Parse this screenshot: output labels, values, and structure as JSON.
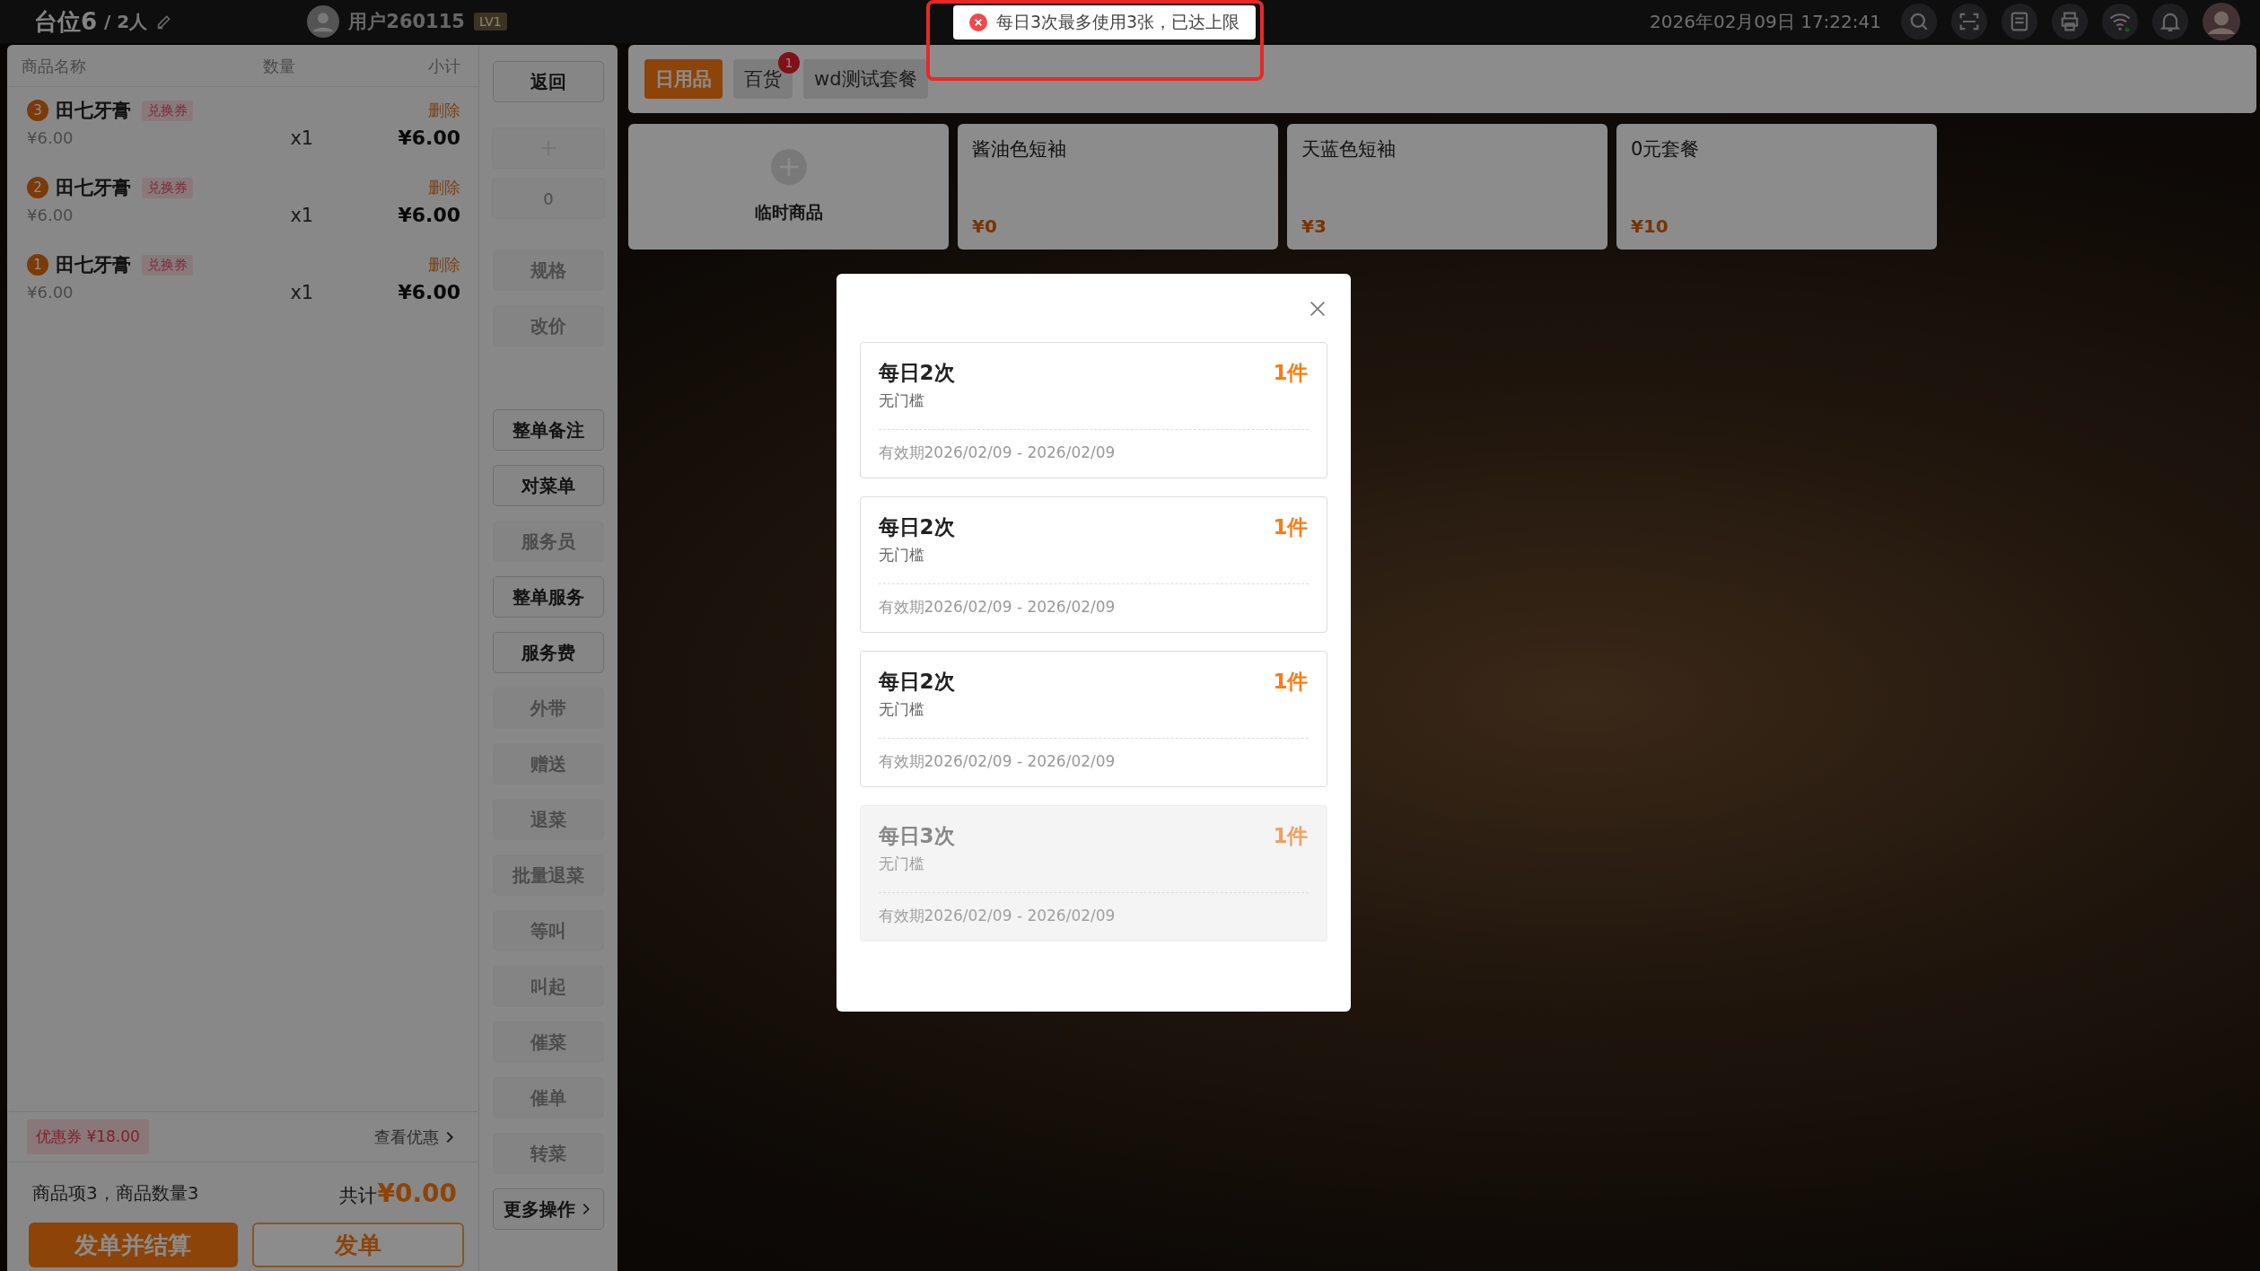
{
  "header": {
    "table": "台位6",
    "guests": "/ 2人",
    "user": "用户260115",
    "level": "LV1",
    "datetime": "2026年02月09日 17:22:41"
  },
  "toast": {
    "message": "每日3次最多使用3张，已达上限"
  },
  "order": {
    "columns": [
      "商品名称",
      "数量",
      "小计"
    ],
    "items": [
      {
        "index": "3",
        "name": "田七牙膏",
        "tag": "兑换券",
        "action": "删除",
        "price": "¥6.00",
        "qty": "x1",
        "subtotal": "¥6.00"
      },
      {
        "index": "2",
        "name": "田七牙膏",
        "tag": "兑换券",
        "action": "删除",
        "price": "¥6.00",
        "qty": "x1",
        "subtotal": "¥6.00"
      },
      {
        "index": "1",
        "name": "田七牙膏",
        "tag": "兑换券",
        "action": "删除",
        "price": "¥6.00",
        "qty": "x1",
        "subtotal": "¥6.00"
      }
    ],
    "coupon": {
      "label": "优惠券 ¥18.00",
      "link": "查看优惠"
    },
    "summary": "商品项3，商品数量3",
    "total_label": "共计",
    "total": "¥0.00",
    "buttons": [
      {
        "label": "发单并结算",
        "kind": "primary"
      },
      {
        "label": "发单",
        "kind": "outline"
      }
    ]
  },
  "actions": {
    "back": "返回",
    "quantity": "0",
    "groups": [
      [
        {
          "label": "规格",
          "disabled": true
        },
        {
          "label": "改价",
          "disabled": true
        }
      ],
      [
        {
          "label": "整单备注",
          "disabled": false
        },
        {
          "label": "对菜单",
          "disabled": false
        },
        {
          "label": "服务员",
          "disabled": true
        },
        {
          "label": "整单服务",
          "disabled": false
        },
        {
          "label": "服务费",
          "disabled": false
        },
        {
          "label": "外带",
          "disabled": true
        },
        {
          "label": "赠送",
          "disabled": true
        },
        {
          "label": "退菜",
          "disabled": true
        },
        {
          "label": "批量退菜",
          "disabled": true
        },
        {
          "label": "等叫",
          "disabled": true
        },
        {
          "label": "叫起",
          "disabled": true
        },
        {
          "label": "催菜",
          "disabled": true
        },
        {
          "label": "催单",
          "disabled": true
        },
        {
          "label": "转菜",
          "disabled": true
        }
      ]
    ],
    "more": "更多操作"
  },
  "categories": [
    {
      "label": "日用品",
      "selected": true
    },
    {
      "label": "百货",
      "selected": false,
      "badge": "1"
    },
    {
      "label": "wd测试套餐",
      "selected": false
    }
  ],
  "products": [
    {
      "kind": "custom",
      "name": "临时商品"
    },
    {
      "kind": "item",
      "name": "酱油色短袖",
      "price": "¥0"
    },
    {
      "kind": "item",
      "name": "天蓝色短袖",
      "price": "¥3"
    },
    {
      "kind": "item",
      "name": "0元套餐",
      "price": "¥10"
    }
  ],
  "dialog": {
    "coupons": [
      {
        "title": "每日2次",
        "condition": "无门槛",
        "count": "1件",
        "validity": "有效期2026/02/09 - 2026/02/09",
        "disabled": false
      },
      {
        "title": "每日2次",
        "condition": "无门槛",
        "count": "1件",
        "validity": "有效期2026/02/09 - 2026/02/09",
        "disabled": false
      },
      {
        "title": "每日2次",
        "condition": "无门槛",
        "count": "1件",
        "validity": "有效期2026/02/09 - 2026/02/09",
        "disabled": false
      },
      {
        "title": "每日3次",
        "condition": "无门槛",
        "count": "1件",
        "validity": "有效期2026/02/09 - 2026/02/09",
        "disabled": true
      }
    ]
  }
}
